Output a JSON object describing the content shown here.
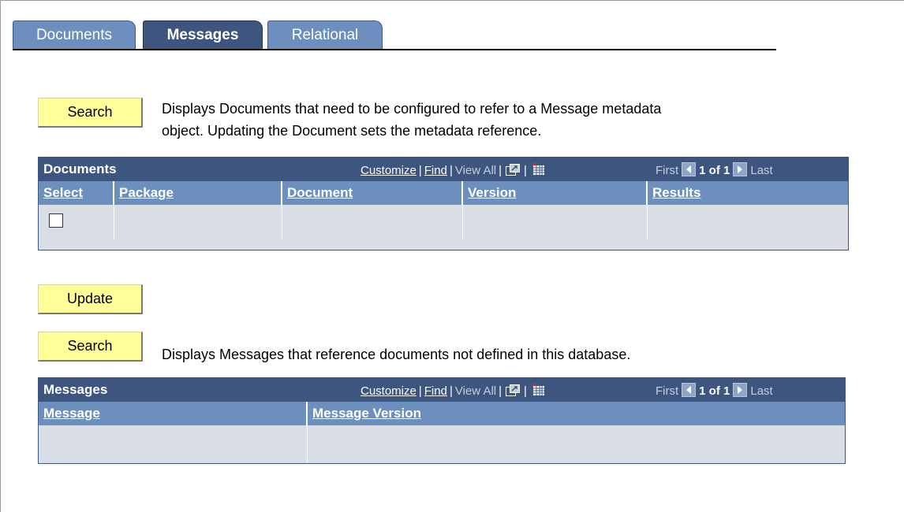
{
  "tabs": [
    {
      "label": "Documents",
      "active": false
    },
    {
      "label": "Messages",
      "active": true
    },
    {
      "label": "Relational",
      "active": false
    }
  ],
  "section1": {
    "search_label": "Search",
    "description_line1": "Displays Documents that need to be configured to refer to a Message metadata",
    "description_line2": "object. Updating the Document sets the metadata reference."
  },
  "documents_grid": {
    "title": "Documents",
    "customize": "Customize",
    "find": "Find",
    "view_all": "View All",
    "sep": "|",
    "first": "First",
    "count": "1 of 1",
    "last": "Last",
    "columns": [
      "Select",
      "Package",
      "Document",
      "Version",
      "Results"
    ],
    "rows": [
      {
        "select": false,
        "package": "",
        "document": "",
        "version": "",
        "results": ""
      }
    ]
  },
  "update_label": "Update",
  "section2": {
    "search_label": "Search",
    "description": "Displays Messages that reference documents not defined in this database."
  },
  "messages_grid": {
    "title": "Messages",
    "customize": "Customize",
    "find": "Find",
    "view_all": "View All",
    "sep": "|",
    "first": "First",
    "count": "1 of 1",
    "last": "Last",
    "columns": [
      "Message",
      "Message Version"
    ],
    "rows": [
      {
        "message": "",
        "message_version": ""
      }
    ]
  },
  "icons": {
    "view_in_window": "new-window-icon",
    "download": "download-grid-icon",
    "prev": "arrow-left-icon",
    "next": "arrow-right-icon"
  },
  "colors": {
    "header_dark": "#3e567f",
    "header_light": "#6c8fbe",
    "row_bg": "#d9dee6",
    "button_bg": "#ffff99"
  }
}
